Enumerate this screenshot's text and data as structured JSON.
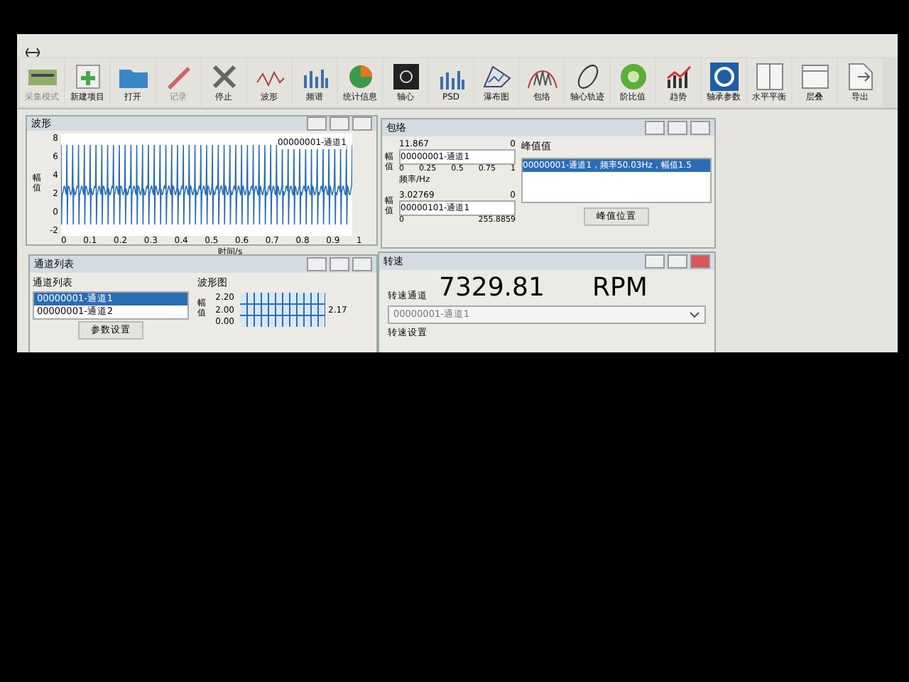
{
  "toolbar": [
    {
      "label": "采集模式",
      "kind": "board",
      "disabled": true
    },
    {
      "label": "新建项目",
      "kind": "add",
      "disabled": false
    },
    {
      "label": "打开",
      "kind": "folder",
      "disabled": false
    },
    {
      "label": "记录",
      "kind": "pen",
      "disabled": true
    },
    {
      "label": "停止",
      "kind": "cross",
      "disabled": false
    },
    {
      "label": "波形",
      "kind": "wave",
      "disabled": false
    },
    {
      "label": "频谱",
      "kind": "bars",
      "disabled": false
    },
    {
      "label": "统计信息",
      "kind": "pie",
      "disabled": false
    },
    {
      "label": "轴心",
      "kind": "scope",
      "disabled": false
    },
    {
      "label": "PSD",
      "kind": "bars",
      "disabled": false
    },
    {
      "label": "瀑布图",
      "kind": "waterfall",
      "disabled": false
    },
    {
      "label": "包络",
      "kind": "envelope",
      "disabled": false
    },
    {
      "label": "轴心轨迹",
      "kind": "orbit",
      "disabled": false
    },
    {
      "label": "阶比值",
      "kind": "gauge",
      "disabled": false
    },
    {
      "label": "趋势",
      "kind": "trend",
      "disabled": false
    },
    {
      "label": "轴承参数",
      "kind": "bearing",
      "disabled": false
    },
    {
      "label": "水平平衡",
      "kind": "split",
      "disabled": false
    },
    {
      "label": "层叠",
      "kind": "layers",
      "disabled": false
    },
    {
      "label": "导出",
      "kind": "export",
      "disabled": false
    }
  ],
  "waveform_window": {
    "title": "波形",
    "ylabel": "幅值",
    "xlabel": "时间/s",
    "legend": "00000001-通道1",
    "yticks": [
      "8",
      "6",
      "4",
      "2",
      "0",
      "-2"
    ],
    "xticks": [
      "0",
      "0.1",
      "0.2",
      "0.3",
      "0.4",
      "0.5",
      "0.6",
      "0.7",
      "0.8",
      "0.9",
      "1"
    ]
  },
  "spectrum_window": {
    "title": "包络",
    "upper": {
      "ylabel": "幅值",
      "ymax": "11.867",
      "ymin": "0",
      "legend": "00000001-通道1",
      "xticks": [
        "0",
        "0.25",
        "0.5",
        "0.75",
        "1"
      ],
      "xlabel": "频率/Hz"
    },
    "lower": {
      "ylabel": "幅值",
      "ymax": "3.02769",
      "ymin": "0",
      "legend": "00000101-通道1",
      "xticks": [
        "0",
        "255.8859"
      ]
    },
    "peaks_header": "峰值值",
    "peaks": [
      {
        "text": "00000001-通道1，频率50.03Hz，幅值1.5",
        "selected": true
      }
    ],
    "button": "峰值位置"
  },
  "channel_window": {
    "title": "通道列表",
    "list_header": "通道列表",
    "channels": [
      {
        "name": "00000001-通道1",
        "selected": true
      },
      {
        "name": "00000001-通道2",
        "selected": false
      }
    ],
    "button": "参数设置",
    "chart_title": "波形图",
    "ylabel": "幅值",
    "yticks": [
      "2.20",
      "2.00",
      "0.00"
    ],
    "readout": "2.17"
  },
  "speed_window": {
    "title": "转速",
    "value": "7329.81",
    "unit": "RPM",
    "channel_label": "转速通道",
    "channel_value": "00000001-通道1",
    "section_label": "转速设置"
  }
}
